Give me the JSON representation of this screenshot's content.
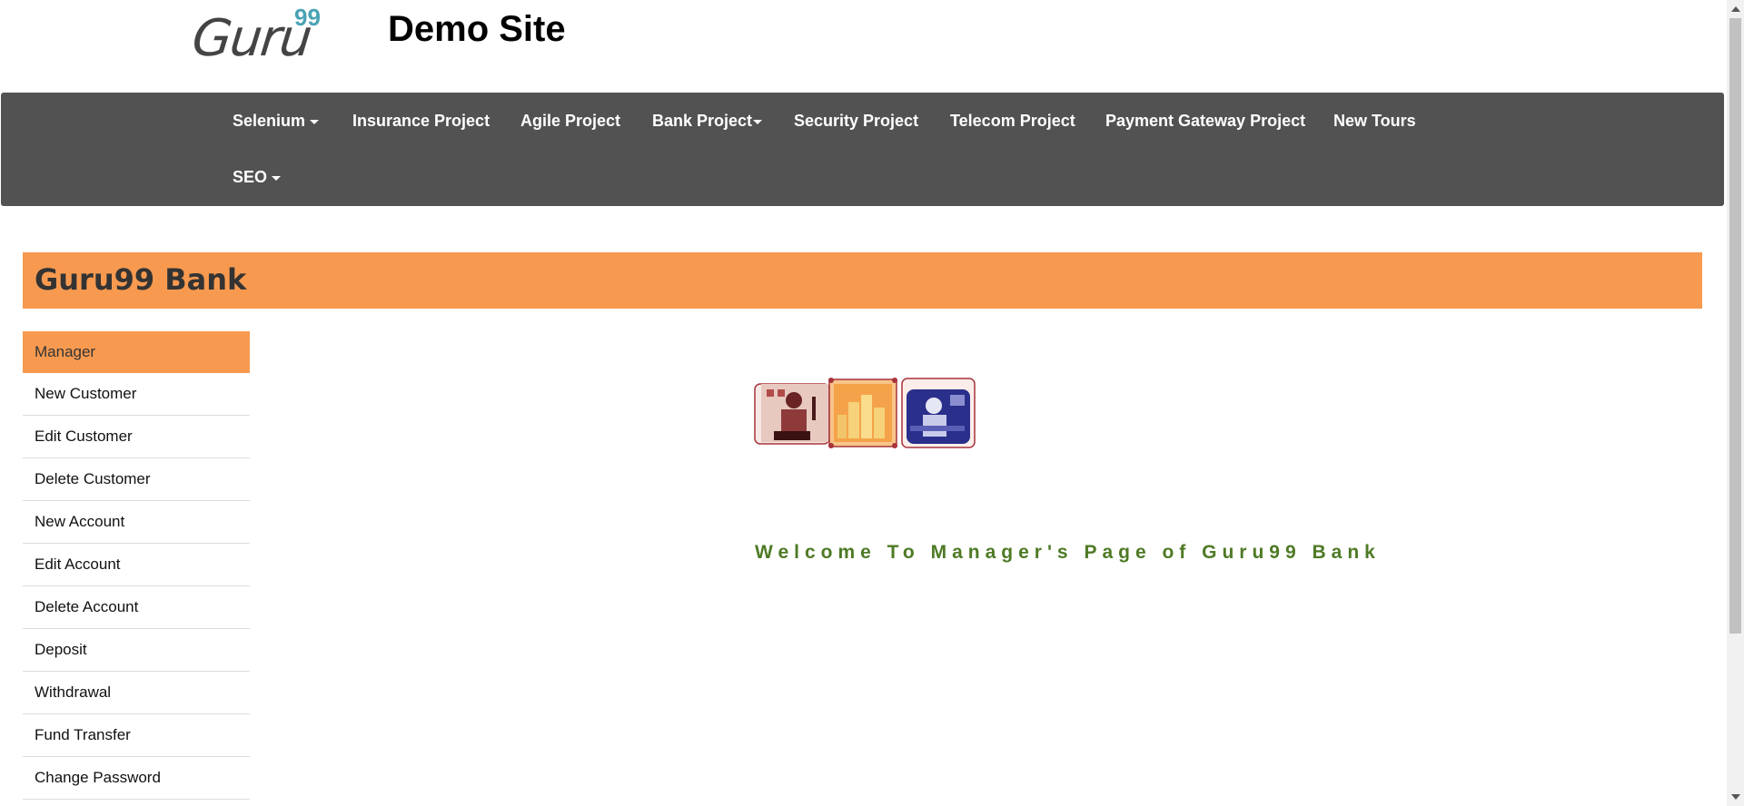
{
  "header": {
    "logo_text": "Guru",
    "logo_sup": "99",
    "site_title": "Demo Site"
  },
  "nav": {
    "items": [
      {
        "label": "Selenium",
        "dropdown": true
      },
      {
        "label": "Insurance Project",
        "dropdown": false
      },
      {
        "label": "Agile Project",
        "dropdown": false
      },
      {
        "label": "Bank Project",
        "dropdown": true
      },
      {
        "label": "Security Project",
        "dropdown": false
      },
      {
        "label": "Telecom Project",
        "dropdown": false
      },
      {
        "label": "Payment Gateway Project",
        "dropdown": false
      },
      {
        "label": "New Tours",
        "dropdown": false
      },
      {
        "label": "SEO",
        "dropdown": true
      }
    ]
  },
  "bank": {
    "title": "Guru99 Bank"
  },
  "sidebar": {
    "items": [
      {
        "label": "Manager",
        "active": true
      },
      {
        "label": "New Customer"
      },
      {
        "label": "Edit Customer"
      },
      {
        "label": "Delete Customer"
      },
      {
        "label": "New Account"
      },
      {
        "label": "Edit Account"
      },
      {
        "label": "Delete Account"
      },
      {
        "label": "Deposit"
      },
      {
        "label": "Withdrawal"
      },
      {
        "label": "Fund Transfer"
      },
      {
        "label": "Change Password"
      }
    ]
  },
  "main": {
    "welcome": "Welcome To Manager's Page of Guru99 Bank"
  },
  "colors": {
    "nav_bg": "#525252",
    "accent": "#f79a50",
    "welcome": "#4e7a25"
  }
}
